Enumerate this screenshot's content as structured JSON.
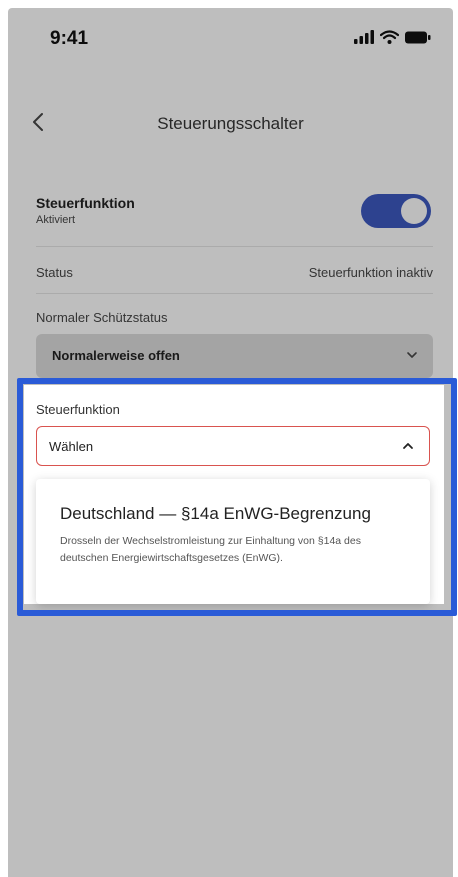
{
  "status_bar": {
    "time": "9:41",
    "icons": [
      "signal-icon",
      "wifi-icon",
      "battery-icon"
    ]
  },
  "nav": {
    "back_icon": "chevron-left-icon",
    "title": "Steuerungsschalter"
  },
  "control_function": {
    "label": "Steuerfunktion",
    "sublabel": "Aktiviert",
    "toggle_on": true
  },
  "status": {
    "label": "Status",
    "value": "Steuerfunktion inaktiv"
  },
  "contactor": {
    "label": "Normaler Schützstatus",
    "value": "Normalerweise offen"
  },
  "selector": {
    "label": "Steuerfunktion",
    "value": "Wählen",
    "options": [
      {
        "title": "Deutschland — §14a EnWG-Begrenzung",
        "description": "Drosseln der Wechselstromleistung zur Einhaltung von §14a des deutschen Energiewirtschaftsgesetzes (EnWG)."
      }
    ]
  },
  "colors": {
    "accent": "#3a55b8",
    "highlight": "#2a5bd7",
    "error_border": "#d9534f"
  }
}
